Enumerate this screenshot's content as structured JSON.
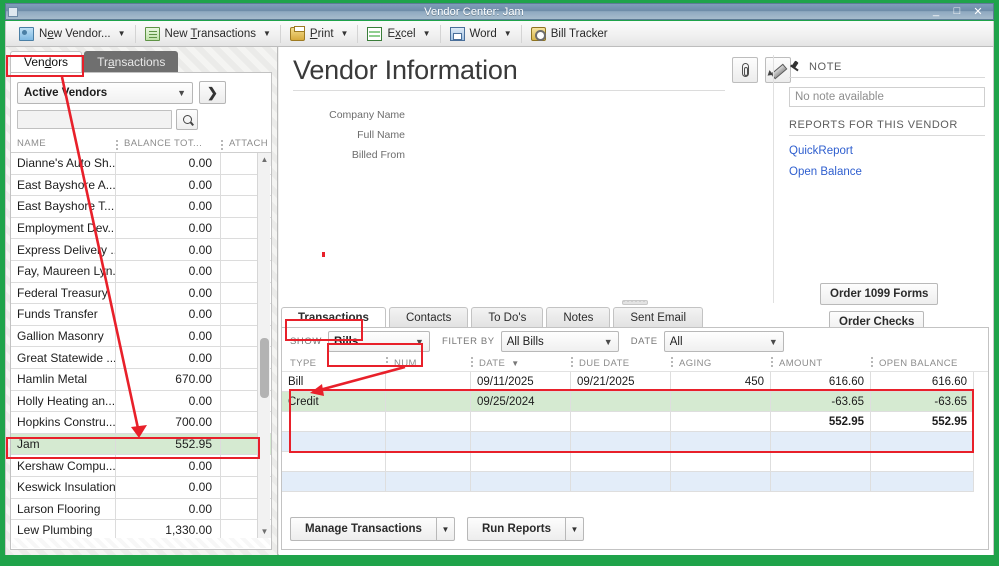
{
  "window": {
    "title": "Vendor Center: Jam",
    "minimize": "_",
    "maximize": "□",
    "close": "✕"
  },
  "toolbar": {
    "items": [
      {
        "label": "New Vendor...",
        "icon": "new-vendor-icon",
        "caret": "▼"
      },
      {
        "label": "New Transactions",
        "icon": "new-transactions-icon",
        "caret": "▼"
      },
      {
        "label": "Print",
        "icon": "print-icon",
        "caret": "▼"
      },
      {
        "label": "Excel",
        "icon": "excel-icon",
        "caret": "▼"
      },
      {
        "label": "Word",
        "icon": "word-icon",
        "caret": "▼"
      },
      {
        "label": "Bill Tracker",
        "icon": "bill-tracker-icon",
        "caret": ""
      }
    ]
  },
  "left_pane": {
    "tabs": [
      {
        "label": "Vendors",
        "active": true
      },
      {
        "label": "Transactions",
        "active": false
      }
    ],
    "view_select": {
      "value": "Active Vendors",
      "caret": "▼"
    },
    "expand_button": "❯",
    "search": {
      "value": "",
      "placeholder": ""
    },
    "search_icon": "magnifier-icon",
    "columns": [
      "NAME",
      "BALANCE TOT...",
      "ATTACH"
    ],
    "rows": [
      {
        "name": "Dianne's Auto Sh...",
        "balance": "0.00",
        "selected": false
      },
      {
        "name": "East Bayshore A...",
        "balance": "0.00",
        "selected": false
      },
      {
        "name": "East Bayshore T...",
        "balance": "0.00",
        "selected": false
      },
      {
        "name": "Employment Dev...",
        "balance": "0.00",
        "selected": false
      },
      {
        "name": "Express Delivery ...",
        "balance": "0.00",
        "selected": false
      },
      {
        "name": "Fay, Maureen Lyn...",
        "balance": "0.00",
        "selected": false
      },
      {
        "name": "Federal Treasury",
        "balance": "0.00",
        "selected": false
      },
      {
        "name": "Funds Transfer",
        "balance": "0.00",
        "selected": false
      },
      {
        "name": "Gallion Masonry",
        "balance": "0.00",
        "selected": false
      },
      {
        "name": "Great Statewide ...",
        "balance": "0.00",
        "selected": false
      },
      {
        "name": "Hamlin Metal",
        "balance": "670.00",
        "selected": false
      },
      {
        "name": "Holly Heating an...",
        "balance": "0.00",
        "selected": false
      },
      {
        "name": "Hopkins Constru...",
        "balance": "700.00",
        "selected": false
      },
      {
        "name": "Jam",
        "balance": "552.95",
        "selected": true
      },
      {
        "name": "Kershaw Compu...",
        "balance": "0.00",
        "selected": false
      },
      {
        "name": "Keswick Insulation",
        "balance": "0.00",
        "selected": false
      },
      {
        "name": "Larson Flooring",
        "balance": "0.00",
        "selected": false
      },
      {
        "name": "Lew Plumbing",
        "balance": "1,330.00",
        "selected": false
      }
    ],
    "scroll_up": "▲",
    "scroll_down": "▼"
  },
  "vendor_information": {
    "title": "Vendor Information",
    "fields": [
      {
        "label": "Company Name",
        "value": ""
      },
      {
        "label": "Full Name",
        "value": ""
      },
      {
        "label": "Billed From",
        "value": ""
      }
    ],
    "attach_icon": "paperclip-icon",
    "edit_icon": "pencil-icon"
  },
  "note_panel": {
    "pin_icon": "pin-icon",
    "note_header": "NOTE",
    "note_value": "No note available",
    "reports_header": "REPORTS FOR THIS VENDOR",
    "links": [
      "QuickReport",
      "Open Balance"
    ],
    "order_buttons": [
      "Order 1099 Forms",
      "Order Checks"
    ]
  },
  "bottom_panel": {
    "tabs": [
      {
        "label": "Transactions",
        "active": true
      },
      {
        "label": "Contacts",
        "active": false
      },
      {
        "label": "To Do's",
        "active": false
      },
      {
        "label": "Notes",
        "active": false
      },
      {
        "label": "Sent Email",
        "active": false
      }
    ],
    "filters": [
      {
        "label": "SHOW",
        "value": "Bills",
        "caret": "▼"
      },
      {
        "label": "FILTER BY",
        "value": "All Bills",
        "caret": "▼"
      },
      {
        "label": "DATE",
        "value": "All",
        "caret": "▼"
      }
    ],
    "columns": [
      "TYPE",
      "NUM",
      "DATE",
      "DUE DATE",
      "AGING",
      "AMOUNT",
      "OPEN BALANCE"
    ],
    "sort_caret": "▼",
    "rows": [
      {
        "type": "Bill",
        "num": "",
        "date": "09/11/2025",
        "due_date": "09/21/2025",
        "aging": "450",
        "amount": "616.60",
        "open_balance": "616.60",
        "style": "plain"
      },
      {
        "type": "Credit",
        "num": "",
        "date": "09/25/2024",
        "due_date": "",
        "aging": "",
        "amount": "-63.65",
        "open_balance": "-63.65",
        "style": "green"
      },
      {
        "type": "",
        "num": "",
        "date": "",
        "due_date": "",
        "aging": "",
        "amount": "552.95",
        "open_balance": "552.95",
        "style": "total"
      },
      {
        "type": "",
        "num": "",
        "date": "",
        "due_date": "",
        "aging": "",
        "amount": "",
        "open_balance": "",
        "style": "alt"
      },
      {
        "type": "",
        "num": "",
        "date": "",
        "due_date": "",
        "aging": "",
        "amount": "",
        "open_balance": "",
        "style": "plain"
      },
      {
        "type": "",
        "num": "",
        "date": "",
        "due_date": "",
        "aging": "",
        "amount": "",
        "open_balance": "",
        "style": "alt"
      }
    ],
    "buttons": [
      {
        "label": "Manage Transactions",
        "caret": "▼"
      },
      {
        "label": "Run Reports",
        "caret": "▼"
      }
    ]
  },
  "annotations": {
    "accent_color": "#e8202a"
  }
}
